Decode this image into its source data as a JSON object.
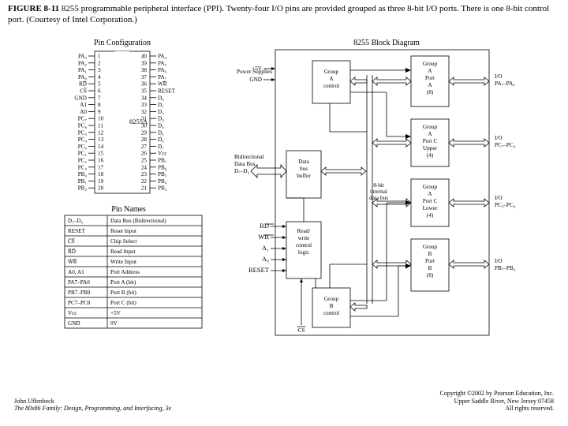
{
  "caption": {
    "label": "FIGURE 8-11",
    "text": "   8255 programmable peripheral interface (PPI). Twenty-four I/O pins are provided grouped as three 8-bit I/O ports. There is one 8-bit control port. (Courtesy of Intel Corporation.)"
  },
  "pin_config_hdr": "Pin Configuration",
  "block_hdr": "8255 Block Diagram",
  "chip_label": "8255A",
  "left_pins": [
    "PA₃",
    "PA₂",
    "PA₁",
    "PA₀",
    "RD̅",
    "CS̅",
    "GND",
    "A1",
    "A0",
    "PC₇",
    "PC₆",
    "PC₅",
    "PC₄",
    "PC₀",
    "PC₁",
    "PC₂",
    "PC₃",
    "PB₀",
    "PB₁",
    "PB₂"
  ],
  "left_nums": [
    "1",
    "2",
    "3",
    "4",
    "5",
    "6",
    "7",
    "8",
    "9",
    "10",
    "11",
    "12",
    "13",
    "14",
    "15",
    "16",
    "17",
    "18",
    "19",
    "20"
  ],
  "right_pins": [
    "PA₄",
    "PA₅",
    "PA₆",
    "PA₇",
    "WR̅",
    "RESET",
    "D₀",
    "D₁",
    "D₂",
    "D₃",
    "D₄",
    "D₅",
    "D₆",
    "D₇",
    "Vcc",
    "PB₇",
    "PB₆",
    "PB₅",
    "PB₄",
    "PB₃"
  ],
  "right_nums": [
    "40",
    "39",
    "38",
    "37",
    "36",
    "35",
    "34",
    "33",
    "32",
    "31",
    "30",
    "29",
    "28",
    "27",
    "26",
    "25",
    "24",
    "23",
    "22",
    "21"
  ],
  "pin_names_hdr": "Pin Names",
  "pin_names": [
    [
      "D₇–D₀",
      "Data Bus (Bidirectional)"
    ],
    [
      "RESET",
      "Reset Input"
    ],
    [
      "C̅S̅",
      "Chip Select"
    ],
    [
      "R̅D̅",
      "Read Input"
    ],
    [
      "W̅R̅",
      "Write Input"
    ],
    [
      "A0, A1",
      "Port Address"
    ],
    [
      "PA7–PA0",
      "Port A (bit)"
    ],
    [
      "PB7–PB0",
      "Port B (bit)"
    ],
    [
      "PC7–PC0",
      "Port C (bit)"
    ],
    [
      "Vcc",
      "+5V"
    ],
    [
      "GND",
      "0V"
    ]
  ],
  "labels": {
    "power": "Power\nSupplies",
    "v5": "+5V",
    "gnd": "GND",
    "bidir": "Bidirectional\nData Bus\nD₇–D₀",
    "grpA": "Group\nA\ncontrol",
    "grpB": "Group\nB\ncontrol",
    "dbb": "Data\nbus\nbuffer",
    "rwc": "Read/\nwrite\ncontrol\nlogic",
    "portA": "Group\nA\nPort\nA\n(8)",
    "portCu": "Group\nA\nPort C\nUpper\n(4)",
    "portCl": "Group\nA\nPort C\nLower\n(4)",
    "portB": "Group\nB\nPort\nB\n(8)",
    "ioA": "I/O\nPA₇–PA₀",
    "ioCu": "I/O\nPC₇–PC₄",
    "ioCl": "I/O\nPC₃–PC₀",
    "ioB": "I/O\nPB₇–PB₀",
    "ibus": "8-bit\ninternal\ndata bus",
    "rd": "R̅D̅",
    "wr": "W̅R̅",
    "a1": "A₁",
    "a0": "A₀",
    "reset": "RESET",
    "cs": "C̅S̅"
  },
  "footer": {
    "author": "John Uffenbeck",
    "book": "The 80x86 Family: Design, Programming, and Interfacing, 3e",
    "copy": "Copyright ©2002 by Pearson Education, Inc.",
    "addr": "Upper Saddle River, New Jersey 07458",
    "rights": "All rights reserved."
  }
}
